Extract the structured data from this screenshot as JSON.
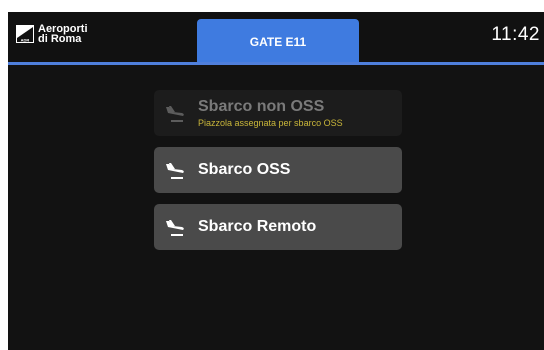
{
  "header": {
    "logo_line1": "Aeroporti",
    "logo_line2": "di Roma",
    "logo_mark_text": "ADR",
    "active_tab": "GATE E11",
    "time": "11:42"
  },
  "options": [
    {
      "label": "Sbarco non OSS",
      "sub": "Piazzola assegnata per sbarco OSS",
      "enabled": false,
      "icon": "plane-landing-icon"
    },
    {
      "label": "Sbarco OSS",
      "enabled": true,
      "icon": "plane-landing-icon"
    },
    {
      "label": "Sbarco Remoto",
      "enabled": true,
      "icon": "plane-landing-icon"
    }
  ],
  "colors": {
    "accent": "#3f7be0",
    "background": "#121212",
    "button": "#4a4a4a",
    "button_disabled": "#1c1c1c",
    "warning_text": "#c9b63a"
  }
}
